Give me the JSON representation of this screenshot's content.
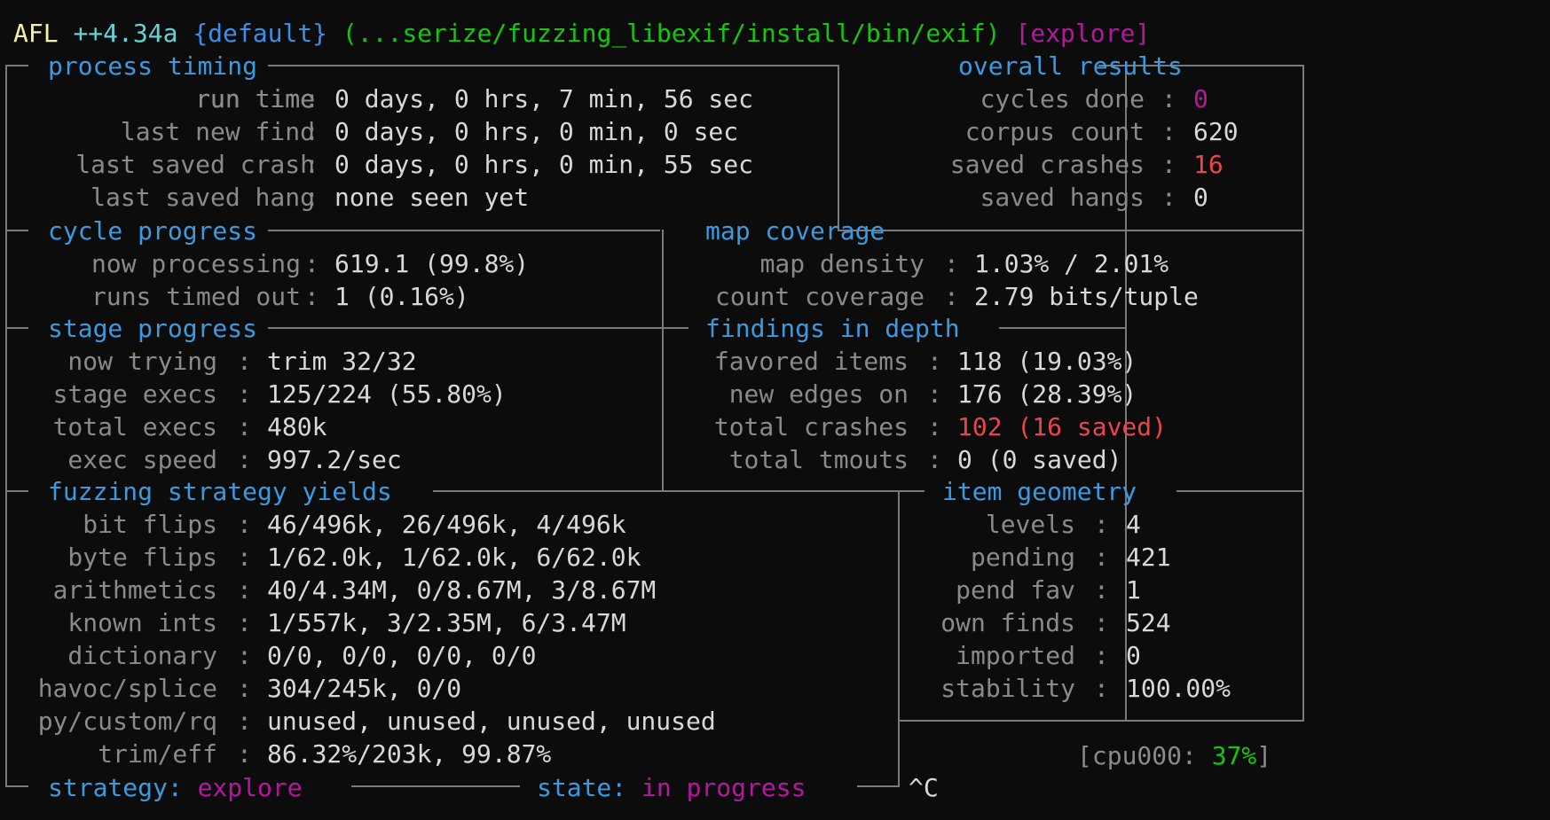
{
  "banner": {
    "afl": "AFL",
    "version": "++4.34a",
    "instance": "{default}",
    "target": "(...serize/fuzzing_libexif/install/bin/exif)",
    "mode": "[explore]"
  },
  "process_timing": {
    "title": "process timing",
    "run_time_label": "run time",
    "run_time": "0 days, 0 hrs, 7 min, 56 sec",
    "last_new_find_label": "last new find",
    "last_new_find": "0 days, 0 hrs, 0 min, 0 sec",
    "last_saved_crash_label": "last saved crash",
    "last_saved_crash": "0 days, 0 hrs, 0 min, 55 sec",
    "last_saved_hang_label": "last saved hang",
    "last_saved_hang": "none seen yet"
  },
  "overall_results": {
    "title": "overall results",
    "cycles_done_label": "cycles done",
    "cycles_done": "0",
    "corpus_count_label": "corpus count",
    "corpus_count": "620",
    "saved_crashes_label": "saved crashes",
    "saved_crashes": "16",
    "saved_hangs_label": "saved hangs",
    "saved_hangs": "0"
  },
  "cycle_progress": {
    "title": "cycle progress",
    "now_processing_label": "now processing",
    "now_processing": "619.1 (99.8%)",
    "runs_timed_out_label": "runs timed out",
    "runs_timed_out": "1 (0.16%)"
  },
  "map_coverage": {
    "title": "map coverage",
    "map_density_label": "map density",
    "map_density": "1.03% / 2.01%",
    "count_coverage_label": "count coverage",
    "count_coverage": "2.79 bits/tuple"
  },
  "stage_progress": {
    "title": "stage progress",
    "now_trying_label": "now trying",
    "now_trying": "trim 32/32",
    "stage_execs_label": "stage execs",
    "stage_execs": "125/224 (55.80%)",
    "total_execs_label": "total execs",
    "total_execs": "480k",
    "exec_speed_label": "exec speed",
    "exec_speed": "997.2/sec"
  },
  "findings_in_depth": {
    "title": "findings in depth",
    "favored_items_label": "favored items",
    "favored_items": "118 (19.03%)",
    "new_edges_on_label": "new edges on",
    "new_edges_on": "176 (28.39%)",
    "total_crashes_label": "total crashes",
    "total_crashes": "102 (16 saved)",
    "total_tmouts_label": "total tmouts",
    "total_tmouts": "0 (0 saved)"
  },
  "strategy_yields": {
    "title": "fuzzing strategy yields",
    "bit_flips_label": "bit flips",
    "bit_flips": "46/496k, 26/496k, 4/496k",
    "byte_flips_label": "byte flips",
    "byte_flips": "1/62.0k, 1/62.0k, 6/62.0k",
    "arithmetics_label": "arithmetics",
    "arithmetics": "40/4.34M, 0/8.67M, 3/8.67M",
    "known_ints_label": "known ints",
    "known_ints": "1/557k, 3/2.35M, 6/3.47M",
    "dictionary_label": "dictionary",
    "dictionary": "0/0, 0/0, 0/0, 0/0",
    "havoc_label": "havoc/splice",
    "havoc": "304/245k, 0/0",
    "py_label": "py/custom/rq",
    "py": "unused, unused, unused, unused",
    "trim_label": "trim/eff",
    "trim": "86.32%/203k, 99.87%"
  },
  "item_geometry": {
    "title": "item geometry",
    "levels_label": "levels",
    "levels": "4",
    "pending_label": "pending",
    "pending": "421",
    "pend_fav_label": "pend fav",
    "pend_fav": "1",
    "own_finds_label": "own finds",
    "own_finds": "524",
    "imported_label": "imported",
    "imported": "0",
    "stability_label": "stability",
    "stability": "100.00%"
  },
  "cpu": {
    "open": "[cpu000:",
    "value": "37%",
    "close": "]"
  },
  "footer": {
    "strategy_label": "strategy:",
    "strategy": "explore",
    "state_label": "state:",
    "state": "in progress",
    "interrupt": "^C"
  },
  "colors": {
    "background": "#0c0c0c",
    "header": "#3b9ae0",
    "crash": "#e8454f",
    "accent": "#b4189e",
    "cpu_ok": "#16c60c"
  }
}
